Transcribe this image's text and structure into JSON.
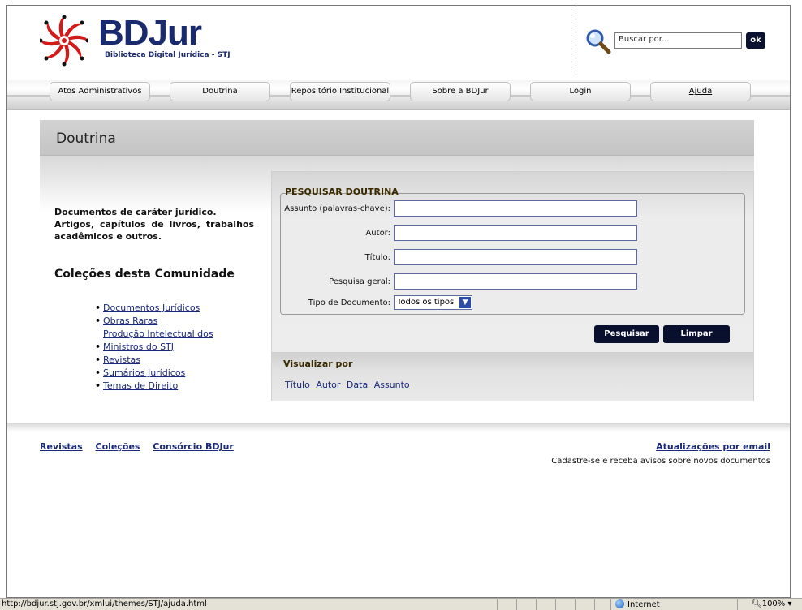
{
  "header": {
    "brand": "BDJur",
    "brand_subtitle": "Biblioteca Digital Jurídica - STJ",
    "search_placeholder": "Buscar por...",
    "search_button": "ok"
  },
  "nav": {
    "tabs": [
      {
        "label": "Atos Administrativos"
      },
      {
        "label": "Doutrina"
      },
      {
        "label": "Repositório Institucional"
      },
      {
        "label": "Sobre a BDJur"
      },
      {
        "label": "Login"
      },
      {
        "label": "Ajuda"
      }
    ]
  },
  "page": {
    "title": "Doutrina",
    "description_lines": [
      "Documentos de caráter jurídico.",
      "Artigos, capítulos de livros, trabalhos acadêmicos e outros."
    ],
    "collections_title": "Coleções desta Comunidade",
    "collections": [
      "Documentos Jurídicos",
      "Obras Raras",
      "Produção Intelectual dos Ministros do STJ",
      "Revistas",
      "Sumários Jurídicos",
      "Temas de Direito"
    ]
  },
  "search_form": {
    "legend": "PESQUISAR DOUTRINA",
    "fields": [
      {
        "label": "Assunto (palavras-chave):",
        "value": ""
      },
      {
        "label": "Autor:",
        "value": ""
      },
      {
        "label": "Título:",
        "value": ""
      },
      {
        "label": "Pesquisa geral:",
        "value": ""
      }
    ],
    "doc_type_label": "Tipo de Documento:",
    "doc_type_value": "Todos os tipos",
    "submit_label": "Pesquisar",
    "clear_label": "Limpar"
  },
  "browse": {
    "title": "Visualizar por",
    "links": [
      "Título",
      "Autor",
      "Data",
      "Assunto"
    ]
  },
  "footer": {
    "links": [
      "Revistas",
      "Coleções",
      "Consórcio BDJur"
    ],
    "email_link": "Atualizações por email",
    "email_text": "Cadastre-se e receba avisos sobre novos documentos"
  },
  "statusbar": {
    "url": "http://bdjur.stj.gov.br/xmlui/themes/STJ/ajuda.html",
    "zone": "Internet",
    "zoom": "100%"
  },
  "colors": {
    "brand_navy": "#1a2a6e",
    "button_dark": "#08102e",
    "logo_red": "#d11a1a"
  }
}
